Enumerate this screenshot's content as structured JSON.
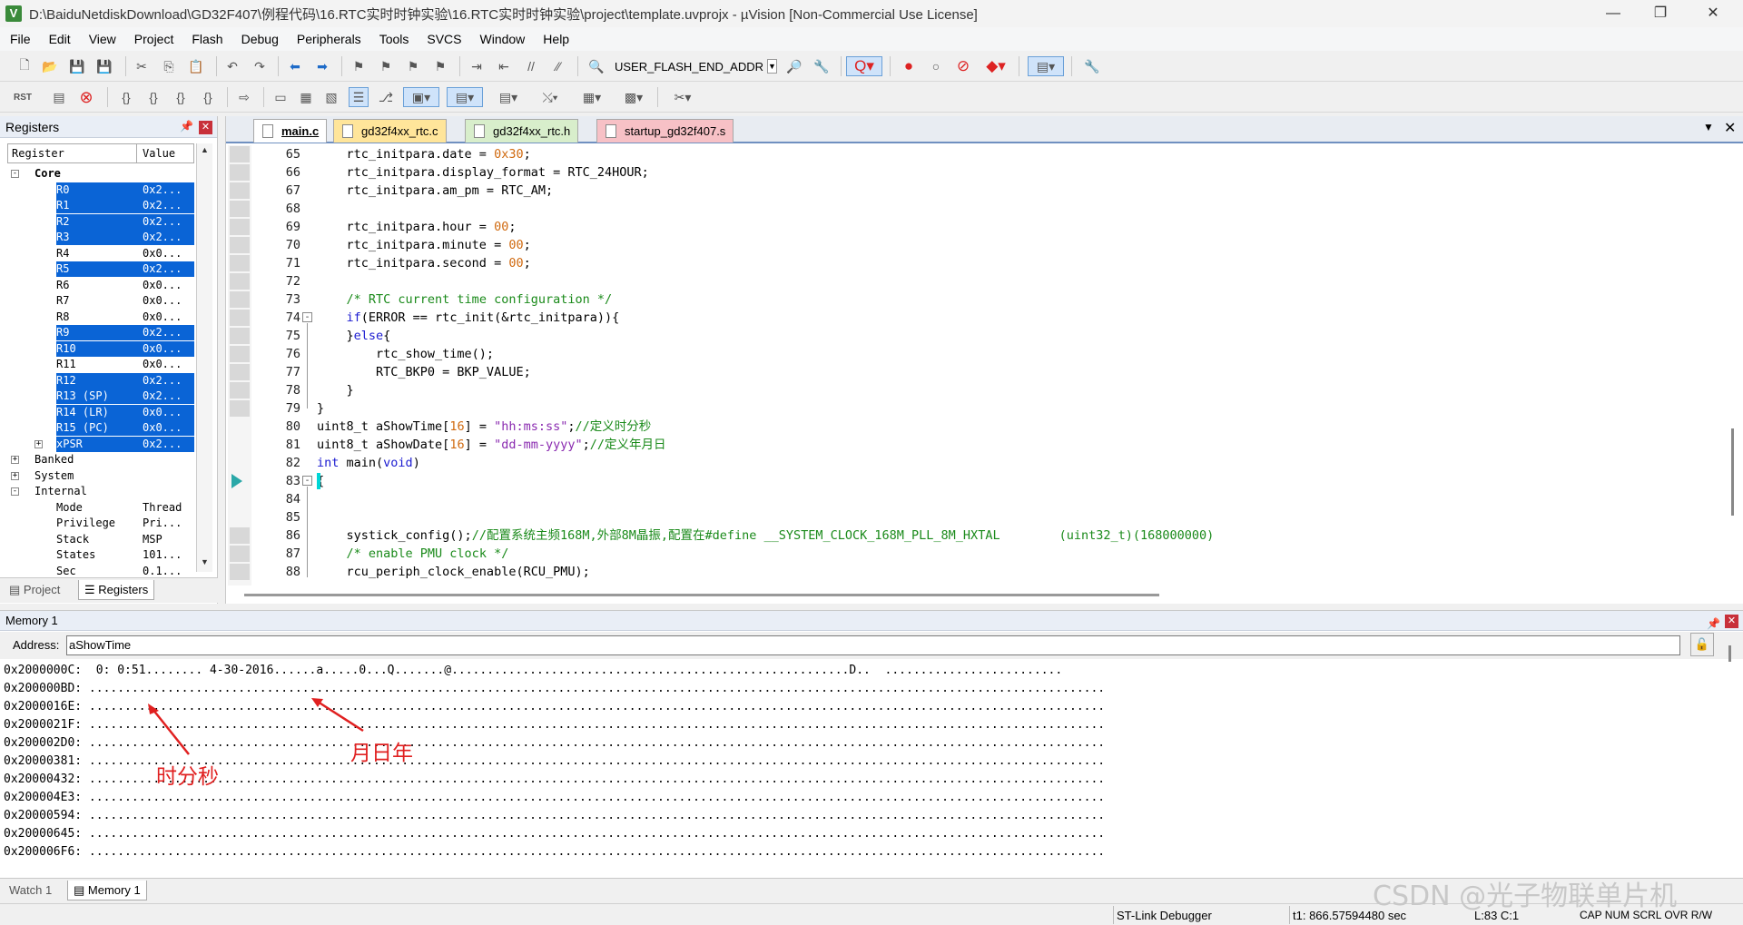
{
  "window": {
    "title": "D:\\BaiduNetdiskDownload\\GD32F407\\例程代码\\16.RTC实时时钟实验\\16.RTC实时时钟实验\\project\\template.uvprojx - µVision  [Non-Commercial Use License]",
    "app_icon": "V",
    "minimize": "—",
    "restore": "❐",
    "close": "✕"
  },
  "menu": [
    "File",
    "Edit",
    "View",
    "Project",
    "Flash",
    "Debug",
    "Peripherals",
    "Tools",
    "SVCS",
    "Window",
    "Help"
  ],
  "toolbar": {
    "target": "USER_FLASH_END_ADDR"
  },
  "registers": {
    "title": "Registers",
    "col_register": "Register",
    "col_value": "Value",
    "core_label": "Core",
    "core_rows": [
      {
        "name": "R0",
        "value": "0x2...",
        "selected": true
      },
      {
        "name": "R1",
        "value": "0x2...",
        "selected": true
      },
      {
        "name": "R2",
        "value": "0x2...",
        "selected": true
      },
      {
        "name": "R3",
        "value": "0x2...",
        "selected": true
      },
      {
        "name": "R4",
        "value": "0x0...",
        "selected": false
      },
      {
        "name": "R5",
        "value": "0x2...",
        "selected": true
      },
      {
        "name": "R6",
        "value": "0x0...",
        "selected": false
      },
      {
        "name": "R7",
        "value": "0x0...",
        "selected": false
      },
      {
        "name": "R8",
        "value": "0x0...",
        "selected": false
      },
      {
        "name": "R9",
        "value": "0x2...",
        "selected": true
      },
      {
        "name": "R10",
        "value": "0x0...",
        "selected": true
      },
      {
        "name": "R11",
        "value": "0x0...",
        "selected": false
      },
      {
        "name": "R12",
        "value": "0x2...",
        "selected": true
      },
      {
        "name": "R13 (SP)",
        "value": "0x2...",
        "selected": true
      },
      {
        "name": "R14 (LR)",
        "value": "0x0...",
        "selected": true
      },
      {
        "name": "R15 (PC)",
        "value": "0x0...",
        "selected": true
      },
      {
        "name": "xPSR",
        "value": "0x2...",
        "selected": true
      }
    ],
    "groups": [
      "Banked",
      "System",
      "Internal"
    ],
    "internal_rows": [
      {
        "name": "Mode",
        "value": "Thread"
      },
      {
        "name": "Privilege",
        "value": "Pri..."
      },
      {
        "name": "Stack",
        "value": "MSP"
      },
      {
        "name": "States",
        "value": "101..."
      },
      {
        "name": "Sec",
        "value": "0.1..."
      }
    ],
    "tabs": [
      "Project",
      "Registers"
    ]
  },
  "editor": {
    "tabs": [
      "main.c",
      "gd32f4xx_rtc.c",
      "gd32f4xx_rtc.h",
      "startup_gd32f407.s"
    ],
    "lines": [
      {
        "no": "65",
        "html": "    rtc_initpara.date = <span class=\"nm\">0x30</span>;"
      },
      {
        "no": "66",
        "html": "    rtc_initpara.display_format = RTC_24HOUR;"
      },
      {
        "no": "67",
        "html": "    rtc_initpara.am_pm = RTC_AM;"
      },
      {
        "no": "68",
        "html": ""
      },
      {
        "no": "69",
        "html": "    rtc_initpara.hour = <span class=\"nm\">00</span>;"
      },
      {
        "no": "70",
        "html": "    rtc_initpara.minute = <span class=\"nm\">00</span>;"
      },
      {
        "no": "71",
        "html": "    rtc_initpara.second = <span class=\"nm\">00</span>;"
      },
      {
        "no": "72",
        "html": ""
      },
      {
        "no": "73",
        "html": "    <span class=\"cm\">/* RTC current time configuration */</span>"
      },
      {
        "no": "74",
        "html": "    <span class=\"kw\">if</span>(ERROR == rtc_init(&amp;rtc_initpara)){"
      },
      {
        "no": "75",
        "html": "    }<span class=\"kw\">else</span>{"
      },
      {
        "no": "76",
        "html": "        rtc_show_time();"
      },
      {
        "no": "77",
        "html": "        RTC_BKP0 = BKP_VALUE;"
      },
      {
        "no": "78",
        "html": "    }"
      },
      {
        "no": "79",
        "html": "}"
      },
      {
        "no": "80",
        "html": "uint8_t aShowTime[<span class=\"nm\">16</span>] = <span class=\"st\">\"hh:ms:ss\"</span>;<span class=\"cm\">//定义时分秒</span>"
      },
      {
        "no": "81",
        "html": "uint8_t aShowDate[<span class=\"nm\">16</span>] = <span class=\"st\">\"dd-mm-yyyy\"</span>;<span class=\"cm\">//定义年月日</span>"
      },
      {
        "no": "82",
        "html": "<span class=\"kw\">int</span> main(<span class=\"kw\">void</span>)"
      },
      {
        "no": "83",
        "html": "{"
      },
      {
        "no": "84",
        "html": ""
      },
      {
        "no": "85",
        "html": ""
      },
      {
        "no": "86",
        "html": "    systick_config();<span class=\"cm\">//配置系统主频168M,外部8M晶振,配置在#define __SYSTEM_CLOCK_168M_PLL_8M_HXTAL        (uint32_t)(168000000)</span>"
      },
      {
        "no": "87",
        "html": "    <span class=\"cm\">/* enable PMU clock */</span>"
      },
      {
        "no": "88",
        "html": "    rcu_periph_clock_enable(RCU_PMU);"
      }
    ]
  },
  "memory": {
    "title": "Memory 1",
    "address_label": "Address:",
    "address_value": "aShowTime",
    "rows": [
      "0x2000000C:  0: 0:51........ 4-30-2016......a.....0...Q.......@........................................................D..  .........................",
      "0x200000BD: ...............................................................................................................................................",
      "0x2000016E: ...............................................................................................................................................",
      "0x2000021F: ...............................................................................................................................................",
      "0x200002D0: ...............................................................................................................................................",
      "0x20000381: ...............................................................................................................................................",
      "0x20000432: ...............................................................................................................................................",
      "0x200004E3: ...............................................................................................................................................",
      "0x20000594: ...............................................................................................................................................",
      "0x20000645: ...............................................................................................................................................",
      "0x200006F6: ..............................................................................................................................................."
    ],
    "annotation_time": "时分秒",
    "annotation_date": "月日年"
  },
  "bottom_tabs": [
    "Watch 1",
    "Memory 1"
  ],
  "status": {
    "debugger": "ST-Link Debugger",
    "time": "t1: 866.57594480 sec",
    "position": "L:83 C:1",
    "indicators": "CAP  NUM  SCRL  OVR  R/W"
  },
  "watermark": "CSDN @光子物联单片机",
  "colors": {
    "selection": "#0a64d6",
    "annotation": "#e02020",
    "keyword": "#1a1ad0",
    "comment": "#1a8a1a"
  }
}
